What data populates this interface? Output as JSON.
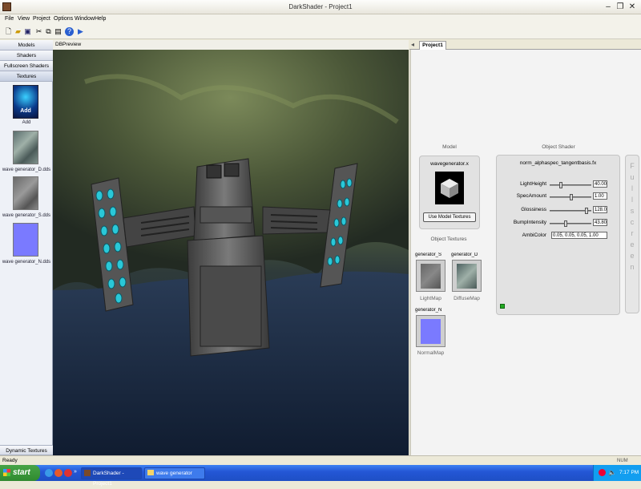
{
  "window": {
    "title": "DarkShader - Project1"
  },
  "menu": [
    "File",
    "View",
    "Project",
    "Options",
    "Window",
    "Help"
  ],
  "left_panel": {
    "categories": [
      "Models",
      "Shaders",
      "Fullscreen Shaders",
      "Textures"
    ],
    "add_label": "Add",
    "textures": [
      "wave generator_D.dds",
      "wave generator_S.dds",
      "wave generator_N.dds"
    ],
    "bottom_category": "Dynamic Textures"
  },
  "viewport": {
    "title": "DBPreview"
  },
  "right_panel": {
    "tab": "Project1",
    "model": {
      "section": "Model",
      "filename": "wavegenerator.x",
      "button": "Use Model Textures"
    },
    "object_textures": {
      "section": "Object Textures",
      "slots": [
        {
          "name": "generator_S",
          "caption": "LightMap"
        },
        {
          "name": "generator_D",
          "caption": "DiffuseMap"
        },
        {
          "name": "generator_N",
          "caption": "NormalMap"
        }
      ]
    },
    "shader": {
      "section": "Object Shader",
      "filename": "norm_alphaspec_tangentbasis.fx",
      "params": [
        {
          "label": "LightHeight",
          "value": "40.00",
          "level": 0.25
        },
        {
          "label": "SpecAmount",
          "value": "1.00",
          "level": 0.55
        },
        {
          "label": "Glossiness",
          "value": "128.0",
          "level": 0.95
        },
        {
          "label": "BumpIntensity",
          "value": "43.80",
          "level": 0.4
        },
        {
          "label": "AmbiColor",
          "value": "0.05, 0.05, 0.05, 1.00"
        }
      ]
    },
    "fullscreen_letters": [
      "F",
      "u",
      "l",
      "l",
      "s",
      "c",
      "r",
      "e",
      "e",
      "n"
    ]
  },
  "status": {
    "text": "Ready",
    "indicator": "NUM"
  },
  "taskbar": {
    "start": "start",
    "tasks": [
      "DarkShader - Project1",
      "wave generator"
    ],
    "clock": "7:17 PM"
  },
  "colors": {
    "taskbar": "#2457d6",
    "normal_map": "#7a7aff",
    "status_green": "#22aa22"
  }
}
